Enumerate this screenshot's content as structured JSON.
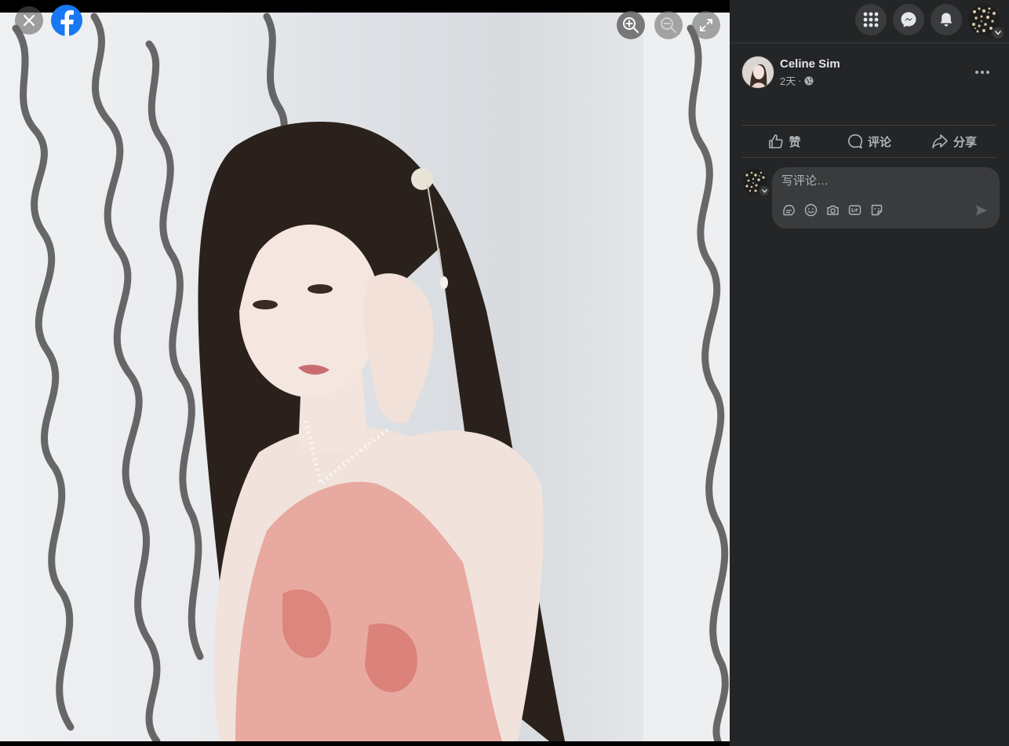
{
  "post": {
    "author_name": "Celine Sim",
    "time": "2天",
    "separator": "·",
    "privacy_icon": "globe-icon"
  },
  "actions": {
    "like_label": "赞",
    "comment_label": "评论",
    "share_label": "分享"
  },
  "comment": {
    "placeholder": "写评论…",
    "tools": [
      "avatar-sticker-icon",
      "emoji-icon",
      "camera-icon",
      "gif-icon",
      "sticker-icon"
    ]
  },
  "top_nav": {
    "icons": [
      "menu-grid-icon",
      "messenger-icon",
      "notifications-bell-icon",
      "account-avatar"
    ]
  },
  "viewer": {
    "controls": [
      "close-icon",
      "facebook-logo",
      "zoom-in-icon",
      "zoom-out-icon",
      "fullscreen-icon"
    ]
  },
  "colors": {
    "panel_bg": "#242526",
    "button_bg": "#3a3b3c",
    "text_primary": "#e4e6eb",
    "text_secondary": "#b0b3b8",
    "brand_blue": "#1877f2"
  }
}
